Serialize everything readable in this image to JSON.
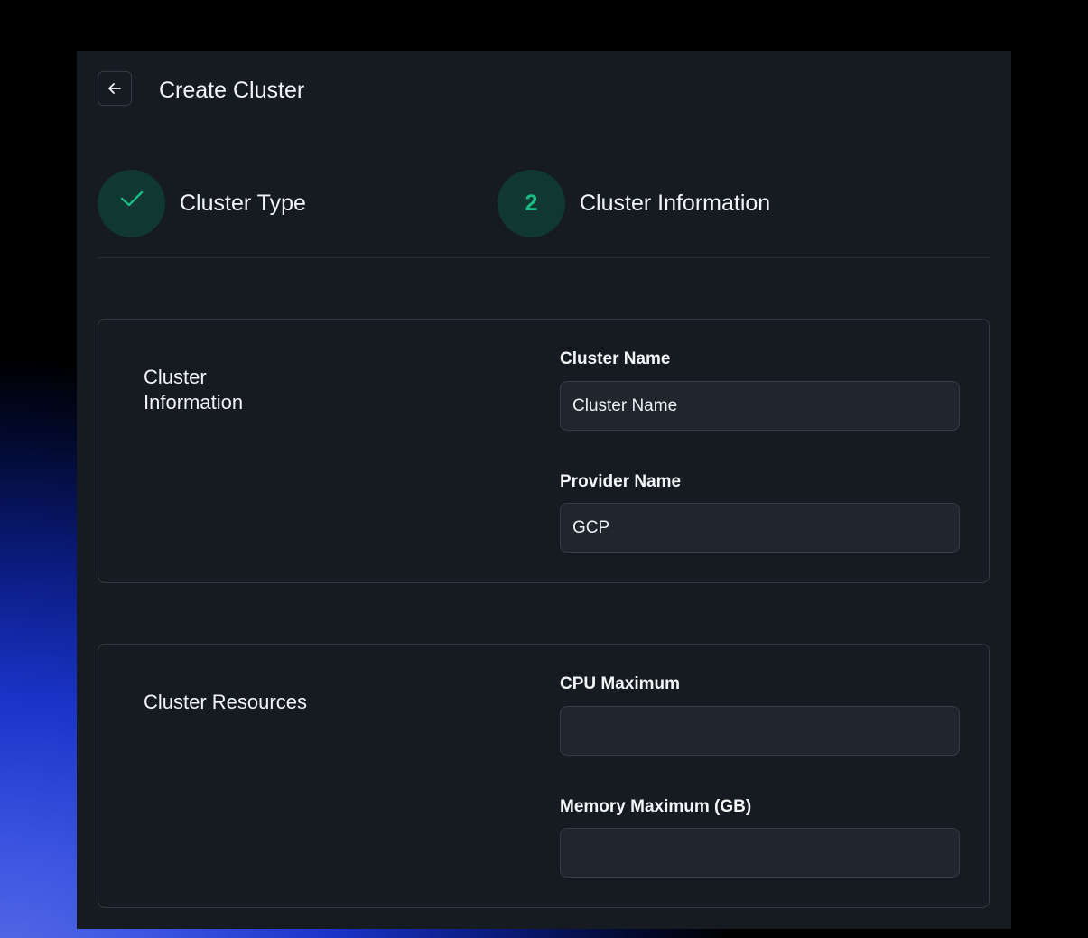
{
  "header": {
    "back_icon": "arrow-left-icon",
    "title": "Create Cluster"
  },
  "steps": [
    {
      "label": "Cluster Type",
      "state": "completed",
      "icon": "checkmark-icon"
    },
    {
      "number": "2",
      "label": "Cluster Information",
      "state": "active"
    }
  ],
  "cluster_information": {
    "title": "Cluster Information",
    "cluster_name": {
      "label": "Cluster Name",
      "placeholder": "Cluster Name",
      "value": ""
    },
    "provider_name": {
      "label": "Provider Name",
      "value": "GCP"
    }
  },
  "cluster_resources": {
    "title": "Cluster Resources",
    "cpu_maximum": {
      "label": "CPU Maximum",
      "value": ""
    },
    "memory_maximum": {
      "label": "Memory Maximum (GB)",
      "value": ""
    }
  },
  "colors": {
    "panel_bg": "#151b21",
    "accent_green": "#1dbb84",
    "step_circle_bg": "#103731",
    "input_bg": "#1f262d",
    "border": "#313a44"
  }
}
